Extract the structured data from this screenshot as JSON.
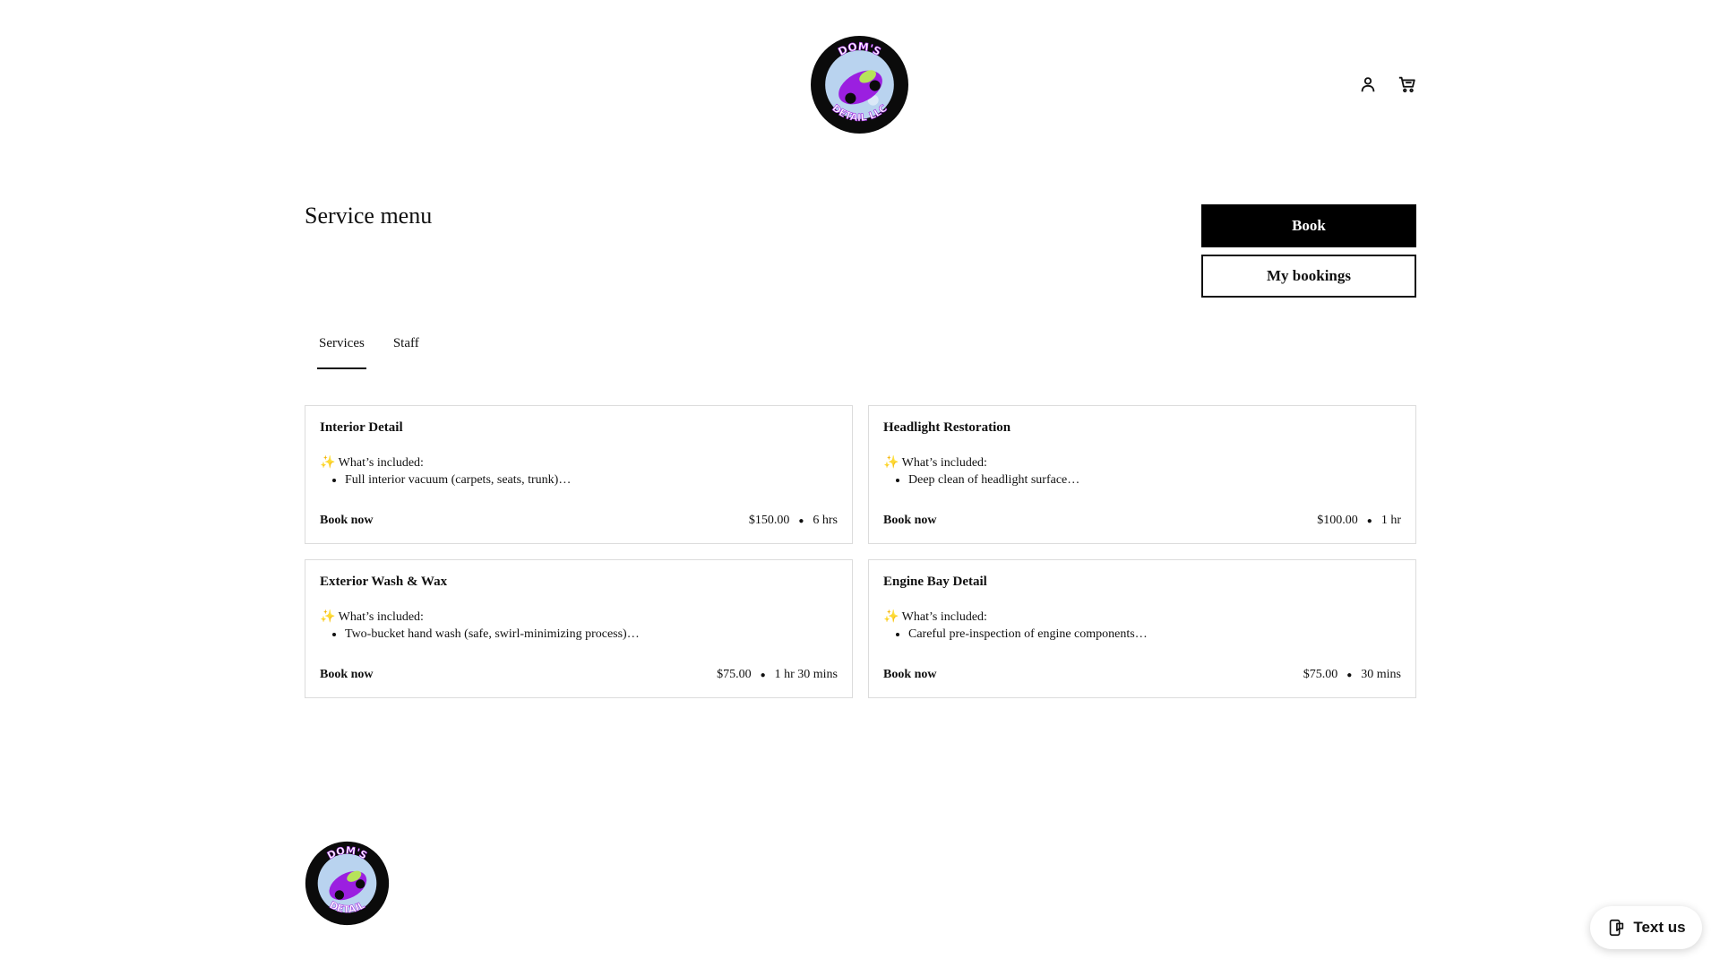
{
  "header": {
    "logo": {
      "text_top": "DOM'S",
      "text_bottom": "DETAIL LLC"
    },
    "icons": [
      "account-icon",
      "cart-icon"
    ]
  },
  "page": {
    "title": "Service menu"
  },
  "actions": {
    "book_label": "Book",
    "my_bookings_label": "My bookings"
  },
  "tabs": [
    {
      "label": "Services",
      "active": true
    },
    {
      "label": "Staff",
      "active": false
    }
  ],
  "services": [
    {
      "title": "Interior Detail",
      "intro": "✨ What’s included:",
      "bullet": "Full interior vacuum (carpets, seats, trunk)…",
      "cta": "Book now",
      "price": "$150.00",
      "duration": "6 hrs"
    },
    {
      "title": "Headlight Restoration",
      "intro": "✨ What’s included:",
      "bullet": "Deep clean of headlight surface…",
      "cta": "Book now",
      "price": "$100.00",
      "duration": "1 hr"
    },
    {
      "title": "Exterior Wash & Wax",
      "intro": "✨ What’s included:",
      "bullet": "Two-bucket hand wash (safe, swirl-minimizing process)…",
      "cta": "Book now",
      "price": "$75.00",
      "duration": "1 hr 30 mins"
    },
    {
      "title": "Engine Bay Detail",
      "intro": "✨ What’s included:",
      "bullet": "Careful pre-inspection of engine components…",
      "cta": "Book now",
      "price": "$75.00",
      "duration": "30 mins"
    }
  ],
  "footer": {
    "logo": {
      "text_top": "DOM'S",
      "text_bottom": "DETAIL"
    }
  },
  "chat_widget": {
    "label": "Text us"
  },
  "colors": {
    "logo_purple": "#9b1fe0",
    "logo_black": "#0b0b0b",
    "accent_green": "#b6e35a",
    "bubble_blue": "#b9d3ef"
  }
}
